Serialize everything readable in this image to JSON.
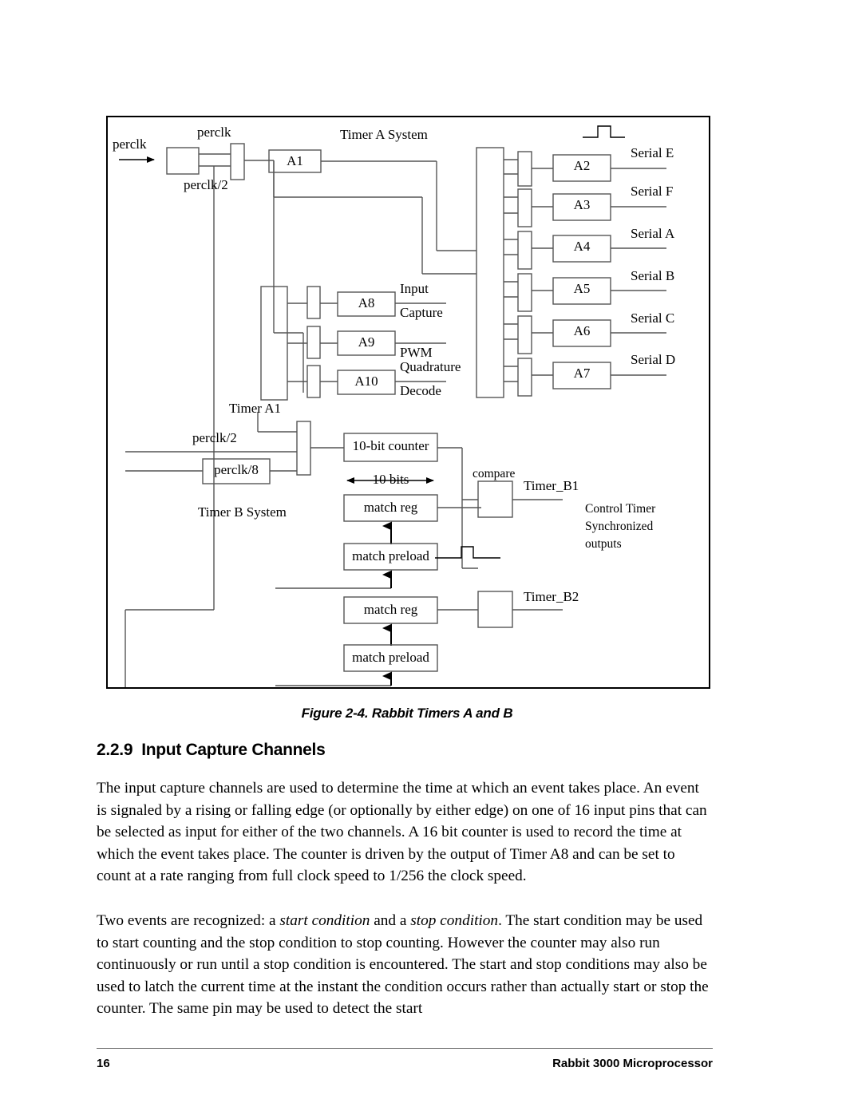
{
  "figure": {
    "caption": "Figure 2-4.  Rabbit Timers A and B",
    "labels": {
      "perclk_input": "perclk",
      "perclk_top": "perclk",
      "perclk_div2_top": "perclk/2",
      "timer_a_system": "Timer A System",
      "a1": "A1",
      "a2": "A2",
      "a3": "A3",
      "a4": "A4",
      "a5": "A5",
      "a6": "A6",
      "a7": "A7",
      "a8": "A8",
      "a9": "A9",
      "a10": "A10",
      "serial_e": "Serial E",
      "serial_f": "Serial F",
      "serial_a": "Serial A",
      "serial_b": "Serial B",
      "serial_c": "Serial C",
      "serial_d": "Serial D",
      "input": "Input",
      "capture": "Capture",
      "pwm": "PWM",
      "quadrature": "Quadrature",
      "decode": "Decode",
      "timer_a1": "Timer A1",
      "perclk_div2_b": "perclk/2",
      "perclk_div8_b": "perclk/8",
      "timer_b_system": "Timer B System",
      "counter_10bit": "10-bit counter",
      "bits_10": "10 bits",
      "match_reg_1": "match reg",
      "match_preload_1": "match preload",
      "match_reg_2": "match reg",
      "match_preload_2": "match preload",
      "compare": "compare",
      "timer_b1": "Timer_B1",
      "timer_b2": "Timer_B2",
      "control_line_1": "Control Timer",
      "control_line_2": "Synchronized",
      "control_line_3": "outputs"
    }
  },
  "section": {
    "number": "2.2.9",
    "title": "Input Capture Channels"
  },
  "body": {
    "paragraph_1_a": "The input capture channels are used to determine the time at which an event takes place. An event is signaled by a rising or falling edge (or optionally by either edge) on one of 16 input pins that can be selected as input for either of the two channels. A 16 bit counter is used to record the time at which the event takes place. The counter is driven by the output of Timer A8 and can be set to count at a rate ranging from full clock speed to 1/256 the clock speed.",
    "paragraph_2_a": "Two events are recognized: a ",
    "paragraph_2_i1": "start condition",
    "paragraph_2_b": " and a ",
    "paragraph_2_i2": "stop condition",
    "paragraph_2_c": ". The start condition may be used to start counting and the stop condition to stop counting. However the counter may also run continuously or run until a stop condition is encountered. The start and stop conditions may also be used to latch the current time at the instant the condition occurs rather than actually start or stop the counter. The same pin may be used to detect the start"
  },
  "footer": {
    "page_number": "16",
    "document_title": "Rabbit 3000 Microprocessor"
  },
  "colors": {
    "ink": "#000000",
    "line": "#555555",
    "page": "#ffffff"
  }
}
